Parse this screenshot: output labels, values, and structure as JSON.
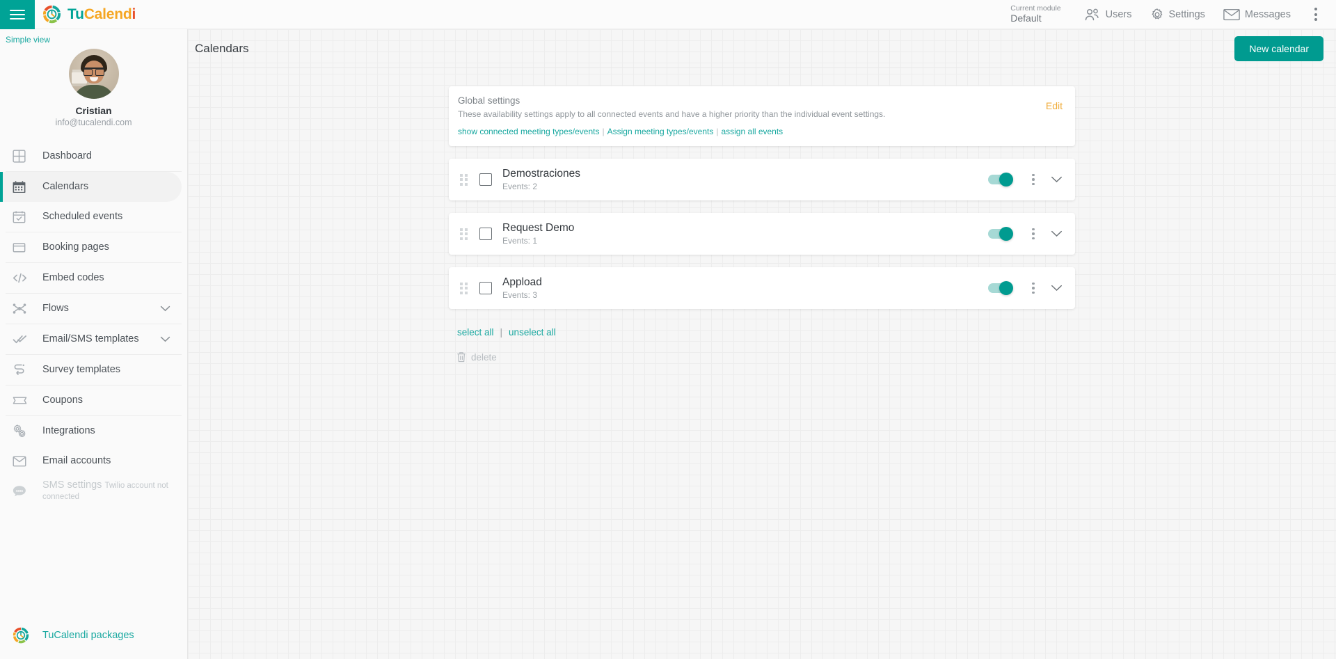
{
  "topbar": {
    "hamburger_icon": "hamburger-menu-icon",
    "logo_icon": "tucalendi-logo-icon",
    "brand": {
      "part1": "Tu",
      "part2": "Calend",
      "part3": "i"
    },
    "module_label": "Current module",
    "module_value": "Default",
    "nav": [
      {
        "label": "Users",
        "icon": "users-icon"
      },
      {
        "label": "Settings",
        "icon": "gear-icon"
      },
      {
        "label": "Messages",
        "icon": "envelope-icon"
      }
    ],
    "kebab_icon": "more-vertical-icon"
  },
  "sidebar": {
    "simple_view": "Simple view",
    "profile": {
      "name": "Cristian",
      "email": "info@tucalendi.com",
      "avatar": "user-avatar"
    },
    "items": [
      {
        "label": "Dashboard",
        "icon": "dashboard-grid-icon",
        "active": false
      },
      {
        "label": "Calendars",
        "icon": "calendar-icon",
        "active": true
      },
      {
        "label": "Scheduled events",
        "icon": "calendar-check-icon",
        "active": false
      },
      {
        "label": "Booking pages",
        "icon": "window-icon",
        "active": false
      },
      {
        "label": "Embed codes",
        "icon": "code-brackets-icon",
        "active": false
      },
      {
        "label": "Flows",
        "icon": "flow-nodes-icon",
        "active": false,
        "chevron": true
      },
      {
        "label": "Email/SMS templates",
        "icon": "double-check-icon",
        "active": false,
        "chevron": true
      },
      {
        "label": "Survey templates",
        "icon": "survey-arrows-icon",
        "active": false
      },
      {
        "label": "Coupons",
        "icon": "ticket-icon",
        "active": false
      },
      {
        "label": "Integrations",
        "icon": "gears-icon",
        "active": false
      },
      {
        "label": "Email accounts",
        "icon": "envelope-icon",
        "active": false
      },
      {
        "label": "SMS settings",
        "icon": "sms-bubble-icon",
        "active": false,
        "disabled": true,
        "sublabel": "Twilio account not connected"
      }
    ],
    "packages": {
      "label": "TuCalendi packages",
      "icon": "tucalendi-logo-icon"
    }
  },
  "page": {
    "title": "Calendars",
    "new_calendar_label": "New calendar"
  },
  "global_settings": {
    "title": "Global settings",
    "description": "These availability settings apply to all connected events and have a higher priority than the individual event settings.",
    "links": [
      "show connected meeting types/events",
      "Assign meeting types/events",
      "assign all events"
    ],
    "separator": "|",
    "edit_label": "Edit"
  },
  "calendars": [
    {
      "name": "Demostraciones",
      "events_label": "Events: 2",
      "checked": false,
      "enabled": true
    },
    {
      "name": "Request Demo",
      "events_label": "Events: 1",
      "checked": false,
      "enabled": true
    },
    {
      "name": "Appload",
      "events_label": "Events: 3",
      "checked": false,
      "enabled": true
    }
  ],
  "bulk": {
    "select_all": "select all",
    "separator": "|",
    "unselect_all": "unselect all",
    "delete_label": "delete",
    "delete_icon": "trash-icon"
  },
  "colors": {
    "teal": "#00a396",
    "teal_link": "#19a8a0",
    "amber": "#f0ad3c",
    "button": "#009b90",
    "muted": "#9aa0a5"
  }
}
